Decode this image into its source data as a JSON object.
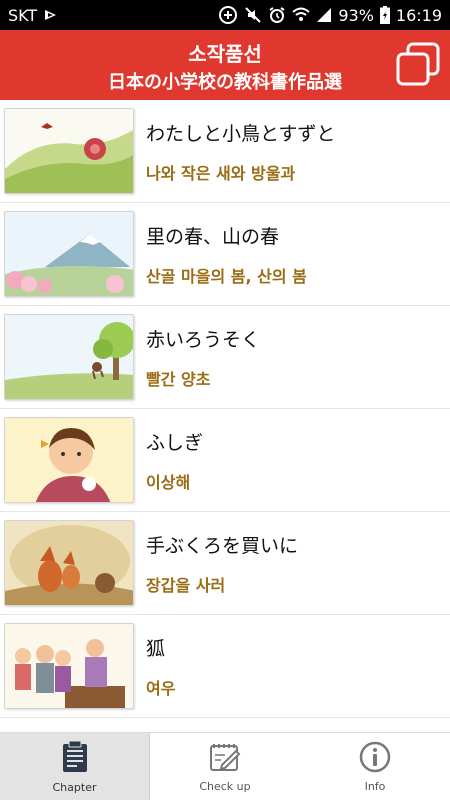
{
  "status_bar": {
    "carrier": "SKT",
    "battery": "93%",
    "time": "16:19",
    "icons": [
      "carrier-media-icon",
      "data-saver-icon",
      "mute-icon",
      "alarm-icon",
      "wifi-icon",
      "signal-icon",
      "battery-icon"
    ]
  },
  "header": {
    "title": "소작품선",
    "subtitle": "日本の小学校の教科書作品選",
    "action_icon": "overlapping-squares-icon"
  },
  "list": {
    "items": [
      {
        "title": "わたしと小鳥とすずと",
        "subtitle": "나와 작은 새와 방울과",
        "thumb": "bird-bell-hill"
      },
      {
        "title": "里の春、山の春",
        "subtitle": "산골 마을의 봄, 산의 봄",
        "thumb": "mountain-spring"
      },
      {
        "title": "赤いろうそく",
        "subtitle": "빨간 양초",
        "thumb": "monkey-tree"
      },
      {
        "title": "ふしぎ",
        "subtitle": "이상해",
        "thumb": "girl-rabbit"
      },
      {
        "title": "手ぶくろを買いに",
        "subtitle": "장갑을 사러",
        "thumb": "fox-den"
      },
      {
        "title": "狐",
        "subtitle": "여우",
        "thumb": "family-scene"
      }
    ]
  },
  "bottom_nav": {
    "items": [
      {
        "label": "Chapter",
        "icon": "clipboard-list-icon",
        "active": true
      },
      {
        "label": "Check up",
        "icon": "notebook-pencil-icon",
        "active": false
      },
      {
        "label": "Info",
        "icon": "info-circle-icon",
        "active": false
      }
    ]
  },
  "colors": {
    "header_bg": "#e0382f",
    "subtitle_text": "#9a6d14",
    "active_tab_bg": "#e3e3e3"
  }
}
